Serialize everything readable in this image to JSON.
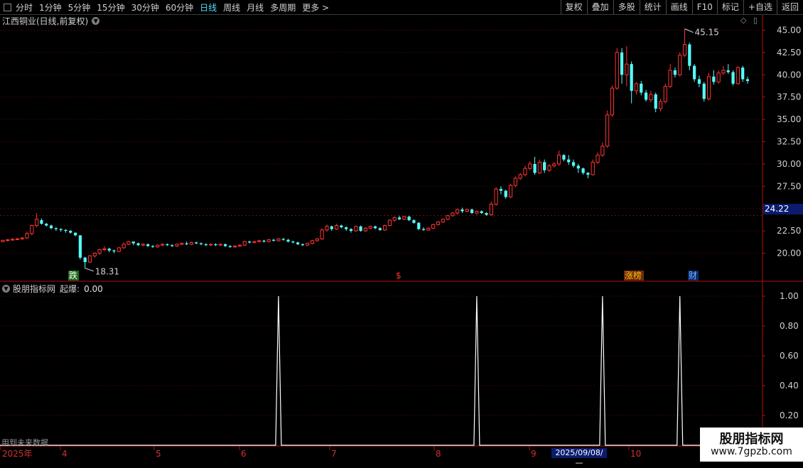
{
  "toolbar": {
    "periods": [
      "分时",
      "1分钟",
      "5分钟",
      "15分钟",
      "30分钟",
      "60分钟",
      "日线",
      "周线",
      "月线",
      "多周期",
      "更多 >"
    ],
    "active": "日线",
    "buttons": [
      "复权",
      "叠加",
      "多股",
      "统计",
      "画线",
      "F10",
      "标记",
      "+自选",
      "返回"
    ]
  },
  "stock": {
    "title": "江西铜业(日线,前复权)",
    "current_price_label": "24.22"
  },
  "indicator": {
    "name": "股朋指标网",
    "label": "起爆:",
    "value": "0.00",
    "future_note": "用到未来数据"
  },
  "badges": {
    "die": "跌",
    "dollar": "$",
    "zhangbang": "涨榜",
    "cai": "财"
  },
  "annotations": {
    "high": "45.15",
    "low": "18.31"
  },
  "date_box": "2025/09/08/—",
  "watermark": {
    "name": "股朋指标网",
    "url": "www.7gpzb.com"
  },
  "chart_data": [
    {
      "type": "candlestick",
      "title": "江西铜业(日线,前复权)",
      "y_ticks": [
        "45.00",
        "42.50",
        "40.00",
        "37.50",
        "35.00",
        "32.50",
        "30.00",
        "27.50",
        "25.00",
        "22.50",
        "20.00"
      ],
      "ylim": [
        18.0,
        46.5
      ],
      "x_ticks": [
        "2025年",
        "4",
        "5",
        "6",
        "7",
        "8",
        "9",
        "10"
      ],
      "up_color": "#ff3333",
      "down_color": "#54ffff",
      "high_label": 45.15,
      "low_label": 18.31,
      "current_price": 24.22,
      "candles": [
        [
          21.3,
          21.45,
          21.2,
          21.5
        ],
        [
          21.45,
          21.5,
          21.3,
          21.6
        ],
        [
          21.5,
          21.55,
          21.4,
          21.7
        ],
        [
          21.55,
          21.6,
          21.45,
          21.7
        ],
        [
          21.6,
          21.7,
          21.5,
          21.8
        ],
        [
          21.7,
          22.2,
          21.6,
          22.4
        ],
        [
          22.2,
          23.1,
          22.0,
          23.2
        ],
        [
          23.1,
          23.8,
          22.9,
          24.5
        ],
        [
          23.7,
          23.3,
          23.2,
          23.9
        ],
        [
          23.3,
          23.1,
          23.0,
          23.4
        ],
        [
          23.1,
          22.8,
          22.7,
          23.2
        ],
        [
          22.8,
          22.7,
          22.5,
          22.9
        ],
        [
          22.7,
          22.6,
          22.4,
          22.8
        ],
        [
          22.6,
          22.5,
          22.3,
          22.7
        ],
        [
          22.5,
          22.3,
          22.2,
          22.6
        ],
        [
          22.3,
          22.0,
          21.9,
          22.3
        ],
        [
          22.0,
          19.5,
          19.3,
          22.0
        ],
        [
          19.5,
          19.0,
          18.31,
          19.6
        ],
        [
          19.0,
          19.7,
          18.9,
          19.8
        ],
        [
          19.7,
          20.0,
          19.5,
          20.1
        ],
        [
          20.0,
          20.4,
          19.8,
          20.5
        ],
        [
          20.4,
          20.5,
          20.2,
          20.8
        ],
        [
          20.5,
          20.3,
          20.1,
          20.6
        ],
        [
          20.3,
          20.2,
          20.0,
          20.4
        ],
        [
          20.2,
          20.6,
          20.1,
          20.7
        ],
        [
          20.6,
          21.0,
          20.5,
          21.2
        ],
        [
          21.0,
          21.3,
          20.9,
          21.4
        ],
        [
          21.3,
          21.1,
          20.9,
          21.3
        ],
        [
          21.1,
          20.9,
          20.8,
          21.2
        ],
        [
          20.9,
          21.0,
          20.8,
          21.1
        ],
        [
          21.0,
          20.8,
          20.7,
          21.1
        ],
        [
          20.8,
          20.7,
          20.6,
          20.9
        ],
        [
          20.7,
          20.9,
          20.6,
          21.0
        ],
        [
          20.9,
          21.0,
          20.8,
          21.1
        ],
        [
          21.0,
          20.9,
          20.8,
          21.1
        ],
        [
          20.9,
          20.8,
          20.7,
          21.0
        ],
        [
          20.8,
          21.0,
          20.7,
          21.1
        ],
        [
          21.0,
          21.1,
          20.9,
          21.2
        ],
        [
          21.1,
          21.0,
          20.9,
          21.3
        ],
        [
          21.0,
          21.2,
          20.9,
          21.3
        ],
        [
          21.2,
          21.1,
          21.0,
          21.3
        ],
        [
          21.1,
          21.0,
          20.9,
          21.2
        ],
        [
          21.0,
          20.9,
          20.8,
          21.1
        ],
        [
          20.9,
          21.0,
          20.8,
          21.1
        ],
        [
          21.0,
          20.9,
          20.8,
          21.1
        ],
        [
          20.9,
          21.0,
          20.8,
          21.1
        ],
        [
          21.0,
          20.8,
          20.7,
          21.1
        ],
        [
          20.8,
          20.7,
          20.6,
          20.9
        ],
        [
          20.7,
          20.8,
          20.6,
          20.9
        ],
        [
          20.8,
          20.9,
          20.7,
          21.0
        ],
        [
          20.9,
          21.3,
          20.8,
          21.4
        ],
        [
          21.3,
          21.2,
          21.1,
          21.4
        ],
        [
          21.2,
          21.3,
          21.1,
          21.4
        ],
        [
          21.3,
          21.4,
          21.2,
          21.5
        ],
        [
          21.4,
          21.3,
          21.2,
          21.5
        ],
        [
          21.3,
          21.5,
          21.2,
          21.6
        ],
        [
          21.5,
          21.4,
          21.3,
          21.6
        ],
        [
          21.4,
          21.6,
          21.3,
          21.7
        ],
        [
          21.6,
          21.5,
          21.4,
          21.7
        ],
        [
          21.5,
          21.3,
          21.2,
          21.6
        ],
        [
          21.3,
          21.2,
          21.1,
          21.4
        ],
        [
          21.2,
          21.0,
          20.9,
          21.3
        ],
        [
          21.0,
          20.9,
          20.8,
          21.1
        ],
        [
          20.9,
          21.1,
          20.8,
          21.2
        ],
        [
          21.1,
          21.4,
          21.0,
          21.5
        ],
        [
          21.4,
          21.6,
          21.3,
          21.7
        ],
        [
          21.6,
          22.6,
          21.5,
          22.8
        ],
        [
          22.6,
          23.0,
          22.4,
          23.2
        ],
        [
          23.0,
          22.7,
          22.5,
          23.1
        ],
        [
          22.7,
          23.1,
          22.6,
          23.3
        ],
        [
          23.1,
          22.9,
          22.8,
          23.2
        ],
        [
          22.9,
          22.7,
          22.5,
          23.0
        ],
        [
          22.7,
          22.5,
          22.3,
          22.8
        ],
        [
          22.5,
          23.0,
          22.4,
          23.1
        ],
        [
          23.0,
          22.5,
          22.4,
          23.1
        ],
        [
          22.5,
          22.8,
          22.4,
          22.9
        ],
        [
          22.8,
          23.0,
          22.7,
          23.1
        ],
        [
          23.0,
          22.8,
          22.7,
          23.1
        ],
        [
          22.8,
          22.6,
          22.5,
          22.9
        ],
        [
          22.6,
          23.1,
          22.5,
          23.2
        ],
        [
          23.1,
          23.7,
          23.0,
          23.8
        ],
        [
          23.7,
          24.0,
          23.5,
          24.1
        ],
        [
          24.0,
          23.8,
          23.7,
          24.2
        ],
        [
          23.8,
          24.1,
          23.7,
          24.2
        ],
        [
          24.1,
          23.7,
          23.6,
          24.2
        ],
        [
          23.7,
          23.4,
          23.3,
          23.8
        ],
        [
          23.4,
          22.7,
          22.6,
          23.5
        ],
        [
          22.7,
          22.6,
          22.5,
          22.9
        ],
        [
          22.6,
          22.8,
          22.5,
          22.9
        ],
        [
          22.8,
          23.2,
          22.7,
          23.3
        ],
        [
          23.2,
          23.5,
          23.1,
          23.6
        ],
        [
          23.5,
          23.8,
          23.4,
          23.9
        ],
        [
          23.8,
          24.2,
          23.7,
          24.3
        ],
        [
          24.2,
          24.5,
          24.1,
          24.6
        ],
        [
          24.5,
          24.9,
          24.3,
          25.0
        ],
        [
          24.9,
          24.7,
          24.5,
          25.1
        ],
        [
          24.7,
          24.9,
          24.6,
          25.0
        ],
        [
          24.9,
          24.5,
          24.4,
          25.0
        ],
        [
          24.5,
          24.7,
          24.3,
          24.8
        ],
        [
          24.7,
          24.5,
          24.4,
          24.8
        ],
        [
          24.5,
          24.3,
          24.2,
          24.6
        ],
        [
          24.3,
          25.5,
          24.2,
          25.8
        ],
        [
          25.5,
          27.2,
          25.3,
          27.4
        ],
        [
          27.2,
          27.0,
          26.6,
          27.5
        ],
        [
          27.0,
          26.3,
          26.1,
          27.1
        ],
        [
          26.3,
          27.6,
          26.2,
          27.8
        ],
        [
          27.6,
          28.4,
          27.4,
          28.6
        ],
        [
          28.4,
          28.8,
          28.2,
          29.0
        ],
        [
          28.8,
          29.5,
          28.6,
          29.8
        ],
        [
          29.5,
          30.0,
          29.3,
          30.3
        ],
        [
          30.0,
          29.0,
          28.8,
          30.8
        ],
        [
          29.0,
          30.2,
          28.9,
          30.5
        ],
        [
          30.2,
          29.3,
          29.0,
          30.5
        ],
        [
          29.3,
          29.8,
          29.1,
          30.0
        ],
        [
          29.8,
          30.0,
          29.6,
          30.2
        ],
        [
          30.0,
          31.0,
          29.8,
          31.5
        ],
        [
          31.0,
          30.5,
          30.3,
          31.1
        ],
        [
          30.5,
          30.2,
          29.9,
          31.0
        ],
        [
          30.2,
          29.8,
          29.6,
          30.5
        ],
        [
          29.8,
          29.5,
          29.0,
          30.0
        ],
        [
          29.5,
          29.0,
          28.8,
          29.6
        ],
        [
          29.0,
          28.8,
          28.4,
          29.1
        ],
        [
          28.8,
          30.2,
          28.7,
          30.5
        ],
        [
          30.2,
          31.0,
          30.0,
          31.3
        ],
        [
          31.0,
          32.0,
          30.8,
          32.4
        ],
        [
          32.0,
          35.5,
          31.8,
          36.0
        ],
        [
          35.5,
          38.5,
          35.3,
          38.8
        ],
        [
          38.5,
          42.5,
          38.3,
          43.0
        ],
        [
          42.5,
          40.0,
          39.0,
          43.0
        ],
        [
          40.0,
          41.2,
          38.7,
          43.2
        ],
        [
          41.2,
          38.2,
          36.8,
          41.5
        ],
        [
          38.2,
          39.0,
          37.8,
          39.2
        ],
        [
          39.0,
          38.0,
          37.7,
          39.3
        ],
        [
          38.0,
          37.2,
          37.0,
          38.3
        ],
        [
          37.2,
          37.8,
          36.9,
          38.2
        ],
        [
          37.8,
          36.2,
          35.8,
          38.0
        ],
        [
          36.2,
          37.0,
          35.9,
          37.3
        ],
        [
          37.0,
          38.7,
          36.8,
          39.0
        ],
        [
          38.7,
          40.5,
          38.5,
          41.2
        ],
        [
          40.5,
          40.0,
          39.7,
          40.8
        ],
        [
          40.0,
          42.2,
          39.8,
          42.5
        ],
        [
          42.2,
          43.4,
          42.0,
          45.15
        ],
        [
          43.4,
          41.0,
          40.5,
          43.6
        ],
        [
          41.0,
          39.5,
          39.2,
          41.2
        ],
        [
          39.5,
          39.0,
          38.6,
          39.9
        ],
        [
          39.0,
          37.3,
          37.0,
          39.2
        ],
        [
          37.3,
          39.8,
          37.1,
          40.2
        ],
        [
          39.8,
          39.2,
          38.9,
          40.5
        ],
        [
          39.2,
          40.2,
          39.0,
          40.5
        ],
        [
          40.2,
          40.5,
          40.0,
          41.0
        ],
        [
          40.5,
          40.3,
          40.1,
          41.2
        ],
        [
          40.3,
          39.0,
          38.8,
          40.5
        ],
        [
          39.0,
          40.8,
          38.9,
          41.0
        ],
        [
          40.8,
          39.5,
          39.2,
          41.0
        ],
        [
          39.5,
          39.3,
          39.0,
          39.8
        ]
      ]
    },
    {
      "type": "line",
      "title": "起爆",
      "y_ticks": [
        "1.00",
        "0.80",
        "0.60",
        "0.40",
        "0.20"
      ],
      "ylim": [
        0,
        1.05
      ],
      "line_color": "#ffffff",
      "pulses": [
        {
          "index": 57,
          "value": 1.0
        },
        {
          "index": 98,
          "value": 1.0
        },
        {
          "index": 124,
          "value": 1.0
        },
        {
          "index": 140,
          "value": 1.0
        }
      ]
    }
  ]
}
